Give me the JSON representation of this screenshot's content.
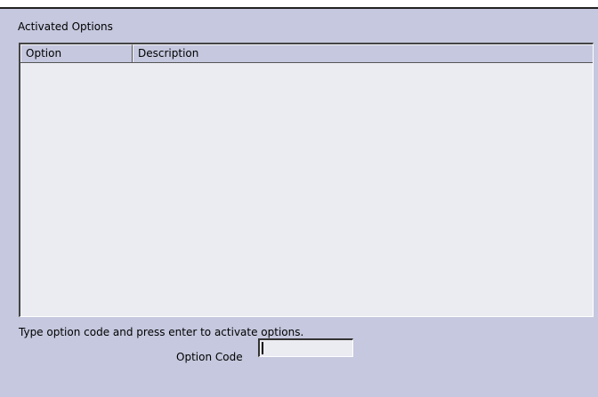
{
  "group": {
    "title": "Activated Options"
  },
  "table": {
    "columns": [
      "Option",
      "Description"
    ],
    "rows": []
  },
  "hint": "Type option code and press enter to activate options.",
  "option_code": {
    "label": "Option Code",
    "value": ""
  }
}
